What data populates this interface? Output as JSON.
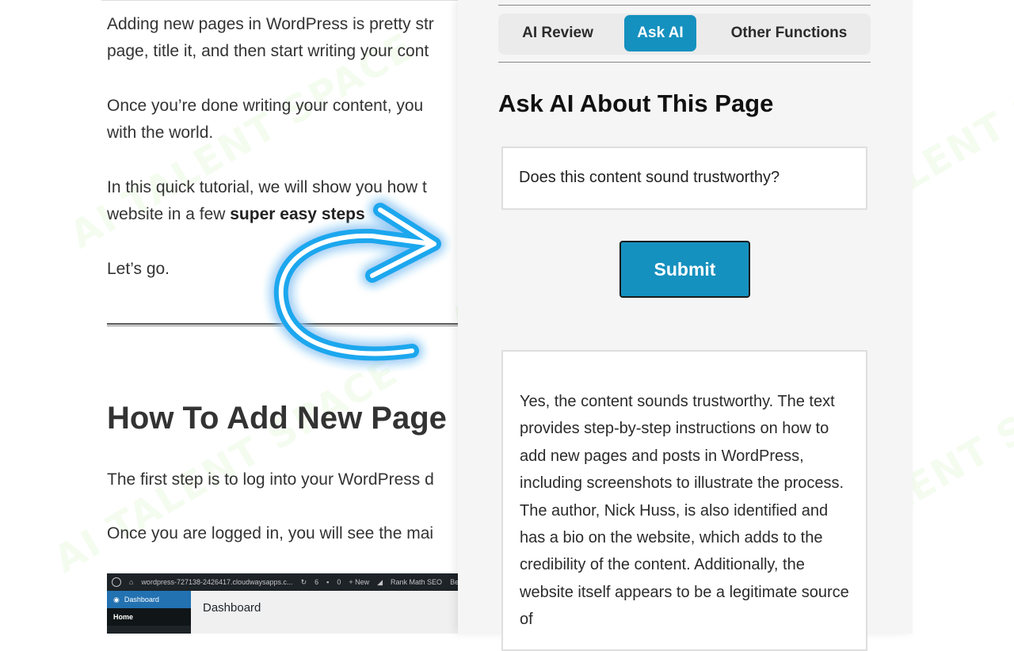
{
  "article": {
    "p1": "Adding new pages in WordPress is pretty str",
    "p1b": "page, title it, and then start writing your cont",
    "p2": "Once you’re done writing your content, you",
    "p2b": "with the world.",
    "p3": "In this quick tutorial, we will show you how t",
    "p3b_prefix": "website in a few ",
    "p3b_bold": "super easy steps",
    "p4": "Let’s go.",
    "heading": "How To Add New Page",
    "p6": "The first step is to log into your WordPress d",
    "p7": "Once you are logged in, you will see the mai"
  },
  "dashboard_screenshot": {
    "toolbar_items": [
      "wordpress-727138-2426417.cloudwaysapps.c...",
      "6",
      "0",
      "+ New",
      "Rank Math SEO",
      "Be"
    ],
    "menu_active": "Dashboard",
    "menu_next": "Home",
    "title": "Dashboard"
  },
  "panel": {
    "tabs": [
      {
        "label": "AI Review",
        "active": false
      },
      {
        "label": "Ask AI",
        "active": true
      },
      {
        "label": "Other Functions",
        "active": false
      }
    ],
    "title": "Ask AI About This Page",
    "question_value": "Does this content sound trustworthy?",
    "submit_label": "Submit",
    "answer": "Yes, the content sounds trustworthy. The text provides step-by-step instructions on how to add new pages and posts in WordPress, including screenshots to illustrate the process. The author, Nick Huss, is also identified and has a bio on the website, which adds to the credibility of the content. Additionally, the website itself appears to be a legitimate source of"
  },
  "watermark": "AI TALENT SPACE",
  "colors": {
    "accent": "#1591bf",
    "arrow": "#3fb6f0",
    "panel_bg": "#f5f5f5"
  }
}
